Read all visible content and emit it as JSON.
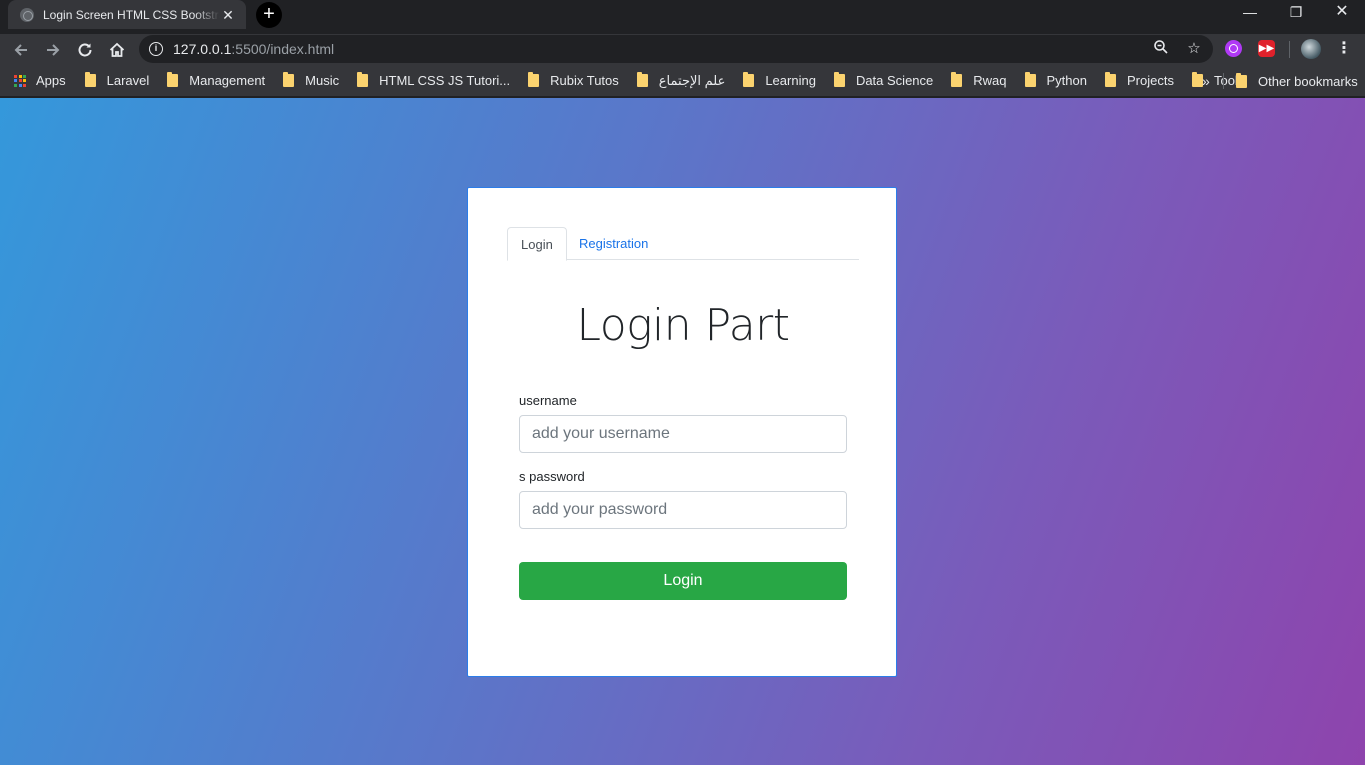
{
  "browser": {
    "tab": {
      "title": "Login Screen HTML CSS Bootstrap",
      "close": "✕"
    },
    "new_tab": "+",
    "window_controls": {
      "minimize": "—",
      "maximize": "❐",
      "close": "✕"
    },
    "nav": {
      "back_icon": "arrow-left-icon",
      "forward_icon": "arrow-right-icon",
      "reload_icon": "reload-icon",
      "home_icon": "home-icon"
    },
    "address": {
      "host": "127.0.0.1",
      "rest": ":5500/index.html"
    },
    "bookmarks": [
      {
        "label": "Apps",
        "type": "apps"
      },
      {
        "label": "Laravel",
        "type": "folder"
      },
      {
        "label": "Management",
        "type": "folder"
      },
      {
        "label": "Music",
        "type": "folder"
      },
      {
        "label": "HTML CSS JS Tutori...",
        "type": "folder"
      },
      {
        "label": "Rubix Tutos",
        "type": "folder"
      },
      {
        "label": "علم الإجتماع",
        "type": "folder"
      },
      {
        "label": "Learning",
        "type": "folder"
      },
      {
        "label": "Data Science",
        "type": "folder"
      },
      {
        "label": "Rwaq",
        "type": "folder"
      },
      {
        "label": "Python",
        "type": "folder"
      },
      {
        "label": "Projects",
        "type": "folder"
      },
      {
        "label": "Tools",
        "type": "folder"
      }
    ],
    "bookmarks_overflow": "»",
    "other_bookmarks": "Other bookmarks"
  },
  "login": {
    "tabs": [
      {
        "label": "Login",
        "active": true
      },
      {
        "label": "Registration",
        "active": false
      }
    ],
    "heading": "Login Part",
    "username": {
      "label": "username",
      "placeholder": "add your username",
      "value": ""
    },
    "password": {
      "label": "s password",
      "placeholder": "add your password",
      "value": ""
    },
    "submit_label": "Login"
  },
  "colors": {
    "gradient_start": "#3498db",
    "gradient_end": "#8e44ad",
    "button": "#28a745",
    "link": "#1a73e8"
  }
}
